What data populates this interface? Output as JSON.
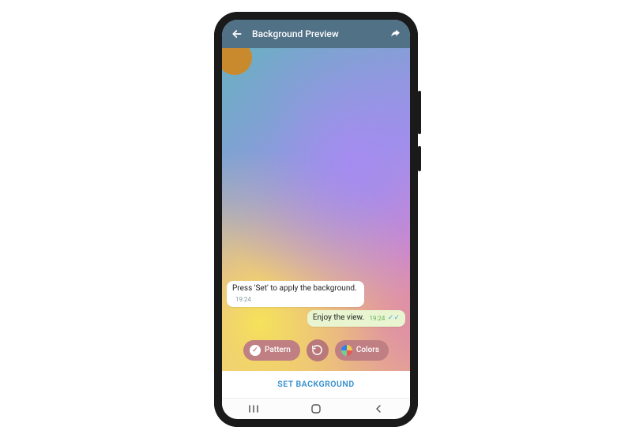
{
  "appbar": {
    "title": "Background Preview",
    "back_icon": "arrow-left",
    "share_icon": "share"
  },
  "messages": {
    "incoming": {
      "text": "Press 'Set' to apply the background.",
      "time": "19:24"
    },
    "outgoing": {
      "text": "Enjoy the view.",
      "time": "19:24"
    }
  },
  "controls": {
    "pattern_label": "Pattern",
    "colors_label": "Colors"
  },
  "actions": {
    "set_background": "SET BACKGROUND"
  }
}
